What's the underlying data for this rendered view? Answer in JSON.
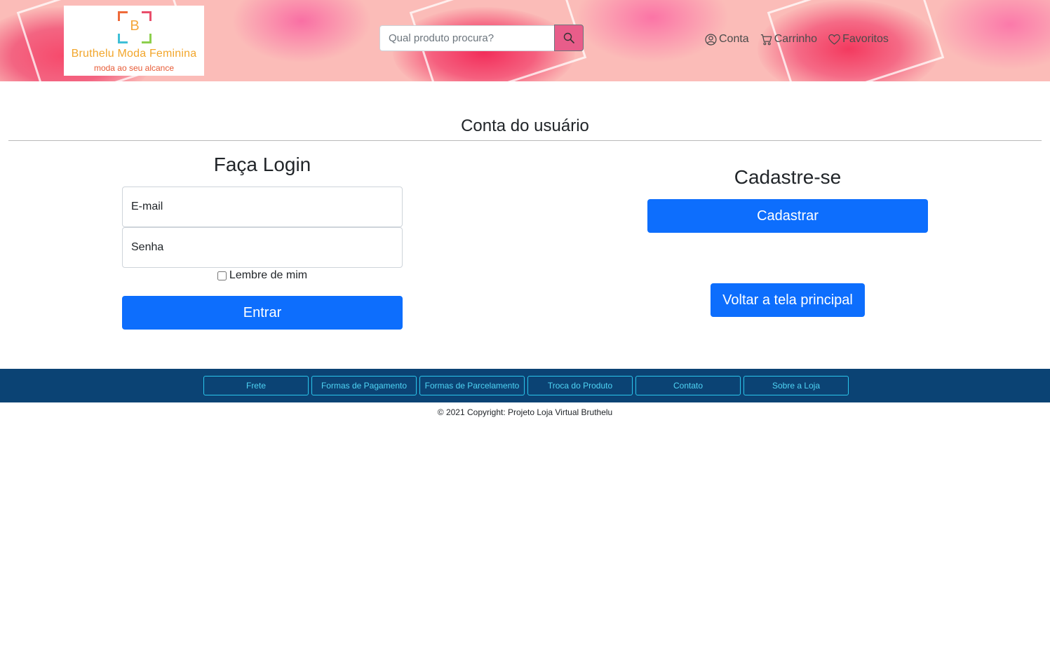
{
  "header": {
    "logo": {
      "letter": "B",
      "name": "Bruthelu Moda Feminina",
      "tagline": "moda ao seu alcance"
    },
    "search": {
      "placeholder": "Qual produto procura?",
      "button_icon": "search-icon"
    },
    "nav": [
      {
        "label": "Conta",
        "icon": "user-circle-icon"
      },
      {
        "label": "Carrinho",
        "icon": "cart-icon"
      },
      {
        "label": "Favoritos",
        "icon": "heart-icon"
      }
    ]
  },
  "main": {
    "title": "Conta do usuário",
    "login": {
      "title": "Faça Login",
      "email_placeholder": "E-mail",
      "password_placeholder": "Senha",
      "remember_label": "Lembre de mim",
      "submit_label": "Entrar"
    },
    "register": {
      "title": "Cadastre-se",
      "register_label": "Cadastrar",
      "back_label": "Voltar a tela principal"
    }
  },
  "footer": {
    "links": [
      "Frete",
      "Formas de Pagamento",
      "Formas de Parcelamento",
      "Troca do Produto",
      "Contato",
      "Sobre a Loja"
    ],
    "copyright": "© 2021 Copyright: Projeto Loja Virtual Bruthelu"
  },
  "colors": {
    "primary": "#0d6efd",
    "footer_bg": "#0b4374",
    "footer_link": "#4fd4f5",
    "header_bg": "#fbbcb8",
    "search_button": "#e85d8a"
  }
}
